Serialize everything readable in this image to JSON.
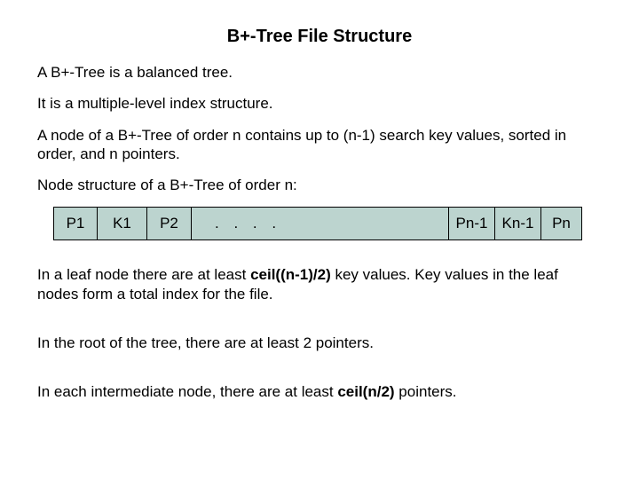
{
  "title": "B+-Tree File Structure",
  "p1": "A B+-Tree is a balanced tree.",
  "p2": "It is a multiple-level index structure.",
  "p3": "A node of a B+-Tree of order n contains up to (n-1) search key values, sorted in order, and n pointers.",
  "p4": "Node structure of a B+-Tree of order n:",
  "node": {
    "c0": "P1",
    "c1": "K1",
    "c2": "P2",
    "dots": ". . . .",
    "c3": "Pn-1",
    "c4": "Kn-1",
    "c5": "Pn"
  },
  "p5a": "In a leaf node there are at least ",
  "p5b": "ceil((n-1)/2)",
  "p5c": " key values.  Key values in the leaf nodes form a total index for the file.",
  "p6": "In the root of the tree, there are at least 2 pointers.",
  "p7a": "In each intermediate node, there are at least ",
  "p7b": "ceil(n/2)",
  "p7c": " pointers."
}
